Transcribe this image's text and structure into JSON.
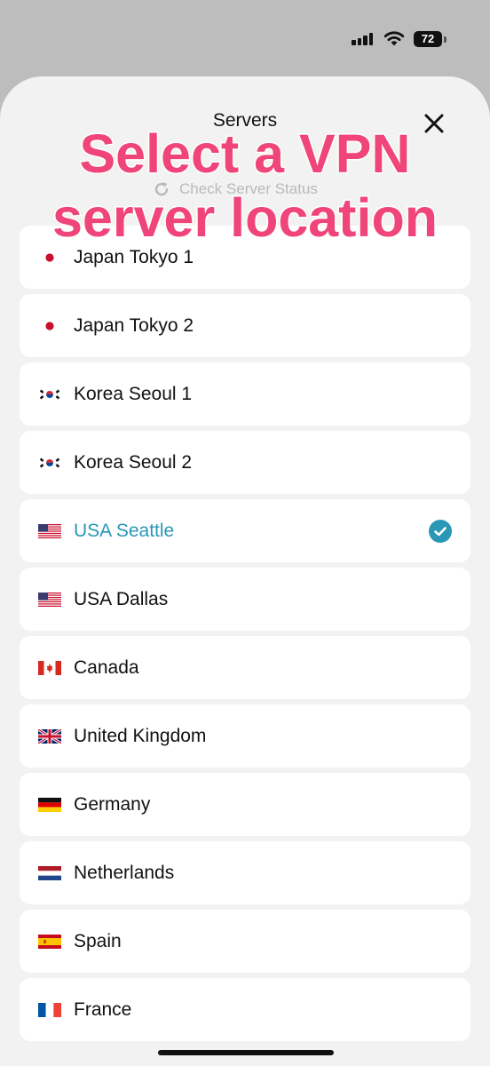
{
  "status_bar": {
    "battery": "72"
  },
  "sheet": {
    "title": "Servers",
    "check_status_label": "Check Server Status"
  },
  "promo": {
    "line1": "Select a VPN",
    "line2": "server location"
  },
  "servers": [
    {
      "name": "Japan Tokyo 1",
      "flag": "japan-flag",
      "selected": false
    },
    {
      "name": "Japan Tokyo 2",
      "flag": "japan-flag",
      "selected": false
    },
    {
      "name": "Korea Seoul 1",
      "flag": "korea-flag",
      "selected": false
    },
    {
      "name": "Korea Seoul 2",
      "flag": "korea-flag",
      "selected": false
    },
    {
      "name": "USA Seattle",
      "flag": "usa-flag",
      "selected": true
    },
    {
      "name": "USA Dallas",
      "flag": "usa-flag",
      "selected": false
    },
    {
      "name": "Canada",
      "flag": "canada-flag",
      "selected": false
    },
    {
      "name": "United Kingdom",
      "flag": "uk-flag",
      "selected": false
    },
    {
      "name": "Germany",
      "flag": "germany-flag",
      "selected": false
    },
    {
      "name": "Netherlands",
      "flag": "netherlands-flag",
      "selected": false
    },
    {
      "name": "Spain",
      "flag": "spain-flag",
      "selected": false
    },
    {
      "name": "France",
      "flag": "france-flag",
      "selected": false
    }
  ],
  "colors": {
    "accent": "#2a97b7",
    "promo": "#f0457a",
    "sheet_bg": "#f2f2f2"
  }
}
